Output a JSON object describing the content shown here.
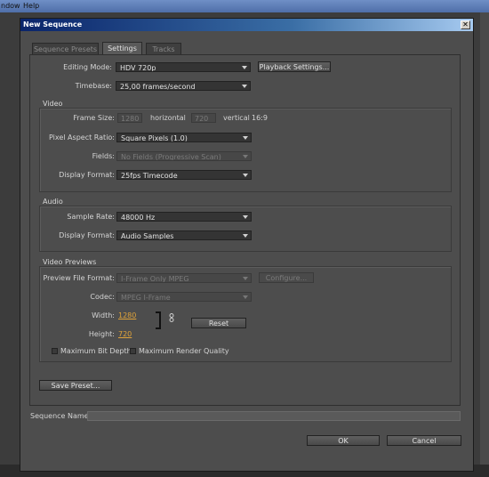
{
  "app": {
    "menu_window": "ndow",
    "menu_help": "Help"
  },
  "dialog": {
    "title": "New Sequence",
    "close_glyph": "✕"
  },
  "tabs": [
    {
      "label": "Sequence Presets",
      "active": false
    },
    {
      "label": "Settings",
      "active": true
    },
    {
      "label": "Tracks",
      "active": false
    }
  ],
  "settings": {
    "editing_mode_label": "Editing Mode:",
    "editing_mode_value": "HDV 720p",
    "playback_settings_button": "Playback Settings...",
    "timebase_label": "Timebase:",
    "timebase_value": "25,00 frames/second"
  },
  "video": {
    "title": "Video",
    "frame_size_label": "Frame Size:",
    "frame_width": "1280",
    "horizontal_label": "horizontal",
    "frame_height": "720",
    "vertical_label": "vertical",
    "aspect_ratio": "16:9",
    "pixel_aspect_label": "Pixel Aspect Ratio:",
    "pixel_aspect_value": "Square Pixels (1.0)",
    "fields_label": "Fields:",
    "fields_value": "No Fields (Progressive Scan)",
    "display_format_label": "Display Format:",
    "display_format_value": "25fps Timecode"
  },
  "audio": {
    "title": "Audio",
    "sample_rate_label": "Sample Rate:",
    "sample_rate_value": "48000 Hz",
    "display_format_label": "Display Format:",
    "display_format_value": "Audio Samples"
  },
  "previews": {
    "title": "Video Previews",
    "file_format_label": "Preview File Format:",
    "file_format_value": "I-Frame Only MPEG",
    "configure_button": "Configure...",
    "codec_label": "Codec:",
    "codec_value": "MPEG I-Frame",
    "width_label": "Width:",
    "width_value": "1280",
    "height_label": "Height:",
    "height_value": "720",
    "link_icon": "chain-link-icon",
    "reset_button": "Reset",
    "max_bit_depth_label": "Maximum Bit Depth",
    "max_bit_depth_checked": false,
    "max_render_quality_label": "Maximum Render Quality",
    "max_render_quality_checked": false
  },
  "save_preset_button": "Save Preset...",
  "sequence_name_label": "Sequence Name:",
  "sequence_name_value": "",
  "ok_button": "OK",
  "cancel_button": "Cancel",
  "colors": {
    "accent_value": "#e0a33a",
    "dialog_bg": "#4d4d4d",
    "titlebar": "#0a246a"
  }
}
